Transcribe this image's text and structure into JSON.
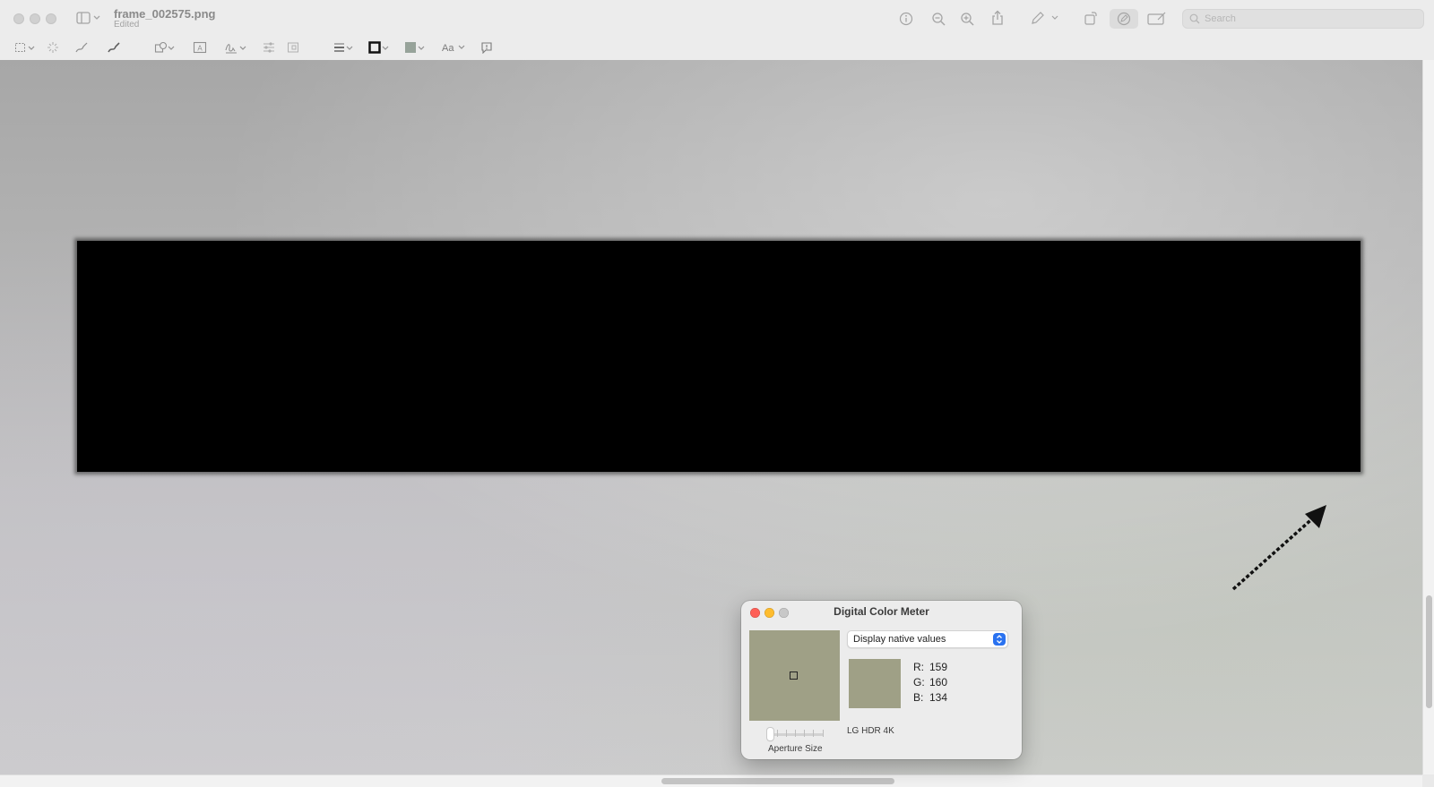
{
  "window": {
    "title": "frame_002575.png",
    "subtitle": "Edited"
  },
  "toolbar": {
    "search_placeholder": "Search",
    "icons": [
      "sidebar-icon",
      "info-icon",
      "zoom-out-icon",
      "zoom-in-icon",
      "share-icon",
      "pen-icon",
      "rotate-icon",
      "markup-icon",
      "crop-icon",
      "search-icon"
    ]
  },
  "markup_toolbar": {
    "icons": [
      "rect-select-icon",
      "instant-alpha-icon",
      "sketch-icon",
      "draw-icon",
      "shapes-icon",
      "text-box-icon",
      "signature-icon",
      "adjust-color-icon",
      "adjust-size-icon",
      "shape-style-icon",
      "border-color-icon",
      "fill-color-icon",
      "font-icon",
      "annotate-icon"
    ],
    "font_label": "Aa"
  },
  "color_meter": {
    "title": "Digital Color Meter",
    "mode": "Display native values",
    "r_label": "R:",
    "g_label": "G:",
    "b_label": "B:",
    "r": "159",
    "g": "160",
    "b": "134",
    "device": "LG HDR 4K",
    "aperture_label": "Aperture Size",
    "sample_color": "#9fa086"
  },
  "colors": {
    "redaction": "#000000",
    "close": "#fe5f57",
    "minimize": "#febc2e",
    "zoom": "#c8c8c8",
    "accent": "#2a72f0"
  }
}
